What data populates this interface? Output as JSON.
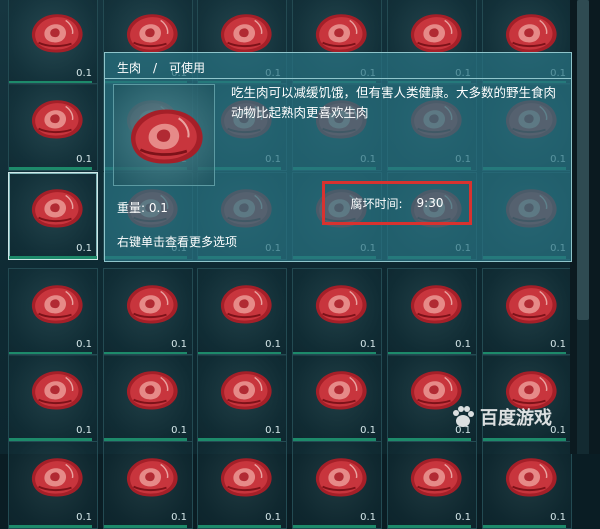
{
  "inventory": {
    "slot_quantity": "0.1",
    "item_icon": "raw-meat-icon"
  },
  "tooltip": {
    "title": "生肉　/　可使用",
    "description": "吃生肉可以减缓饥饿，但有害人类健康。大多数的野生食肉动物比起熟肉更喜欢生肉",
    "weight": "重量:  0.1",
    "spoil_label": "腐坏时间:",
    "spoil_value": "9:30",
    "hint": "右键单击查看更多选项"
  },
  "watermark": {
    "text": "百度游戏",
    "icon": "baidu-paw-icon"
  },
  "colors": {
    "highlight_box": "#d8322f",
    "durability_bar": "#1d8a6a",
    "tooltip_border": "#8fc5cb"
  }
}
